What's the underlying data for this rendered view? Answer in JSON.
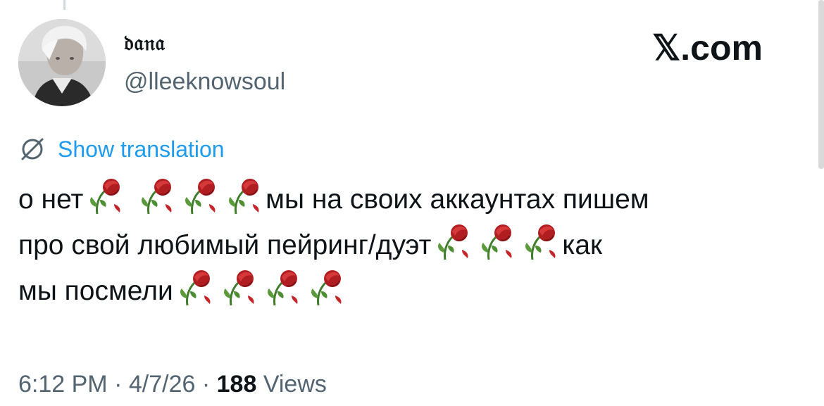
{
  "tweet": {
    "author": {
      "display_name": "𝔡𝔞𝔫𝔞",
      "handle": "@lleeknowsoul"
    },
    "brand": "𝕏.com",
    "translate_label": "Show translation",
    "text_lines": [
      {
        "segments": [
          {
            "kind": "text",
            "value": "о нет"
          },
          {
            "kind": "emoji",
            "name": "wilted-flower-icon"
          },
          {
            "kind": "text",
            "value": " "
          },
          {
            "kind": "emoji",
            "name": "wilted-flower-icon"
          },
          {
            "kind": "emoji",
            "name": "wilted-flower-icon"
          },
          {
            "kind": "emoji",
            "name": "wilted-flower-icon"
          },
          {
            "kind": "text",
            "value": "мы на своих аккаунтах пишем"
          }
        ]
      },
      {
        "segments": [
          {
            "kind": "text",
            "value": "про свой любимый пейринг/дуэт"
          },
          {
            "kind": "emoji",
            "name": "wilted-flower-icon"
          },
          {
            "kind": "emoji",
            "name": "wilted-flower-icon"
          },
          {
            "kind": "emoji",
            "name": "wilted-flower-icon"
          },
          {
            "kind": "text",
            "value": "как"
          }
        ]
      },
      {
        "segments": [
          {
            "kind": "text",
            "value": "мы посмели"
          },
          {
            "kind": "emoji",
            "name": "wilted-flower-icon"
          },
          {
            "kind": "emoji",
            "name": "wilted-flower-icon"
          },
          {
            "kind": "emoji",
            "name": "wilted-flower-icon"
          },
          {
            "kind": "emoji",
            "name": "wilted-flower-icon"
          }
        ]
      }
    ],
    "meta": {
      "time": "6:12 PM",
      "separator": "·",
      "date": "4/7/26",
      "views_count": "188",
      "views_label": "Views"
    }
  },
  "colors": {
    "text": "#0f1419",
    "secondary": "#536471",
    "link": "#1d9bf0"
  }
}
